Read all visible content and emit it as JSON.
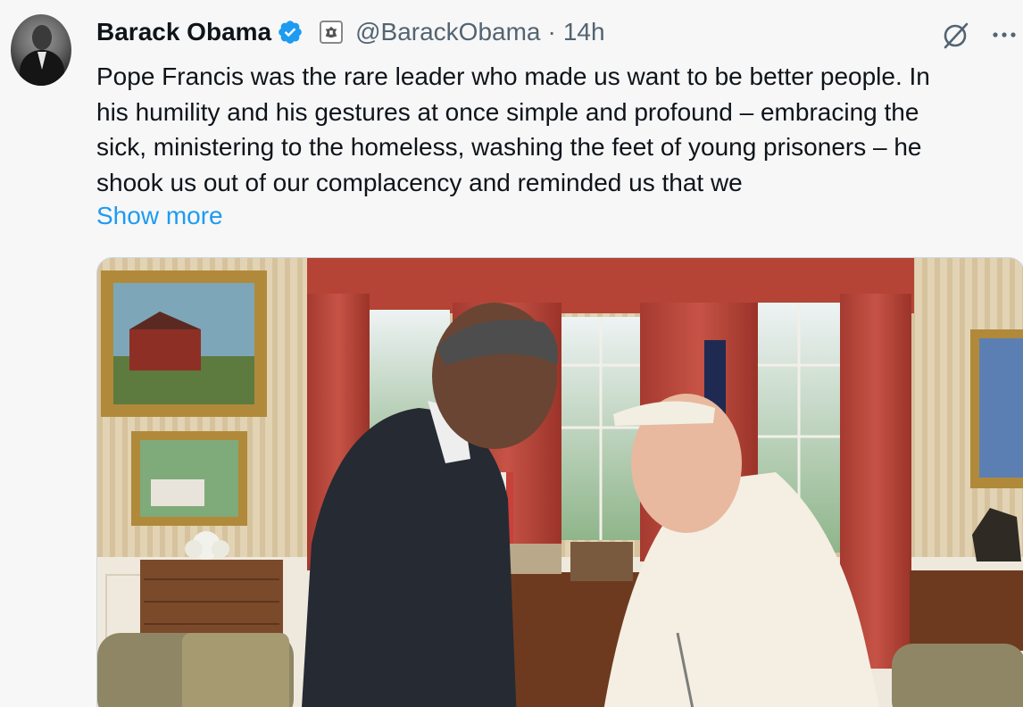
{
  "author": {
    "name": "Barack Obama",
    "handle": "@BarackObama",
    "separator": "·",
    "timestamp": "14h"
  },
  "tweet": {
    "lines": [
      "Pope Francis was the rare leader who made us want to be better people. In",
      "his humility and his gestures at once simple and profound – embracing the",
      "sick, ministering to the homeless, washing the feet of young prisoners – he",
      "shook us out of our complacency and reminded us that we"
    ],
    "show_more": "Show more"
  },
  "icons": {
    "verified": "verified-badge-icon",
    "affiliate": "government-seal-icon",
    "grok": "grok-icon",
    "more": "more-options-icon"
  },
  "colors": {
    "accent": "#1d9bf0",
    "text": "#0f1419",
    "secondary": "#536471",
    "background": "#f7f7f8"
  }
}
